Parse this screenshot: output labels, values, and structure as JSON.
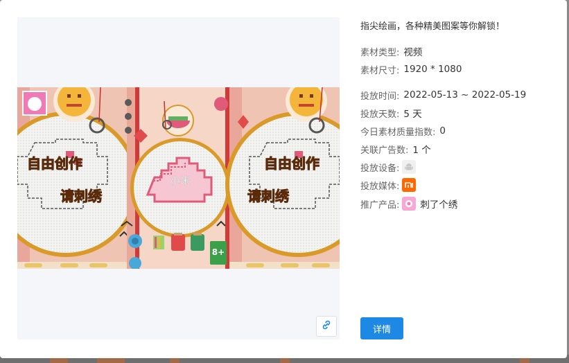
{
  "modal": {
    "title": "指尖绘画，各种精美图案等你解锁！",
    "fields": [
      {
        "label": "素材类型:",
        "value": "视频"
      },
      {
        "label": "素材尺寸:",
        "value": "1920 * 1080"
      },
      {
        "label": "投放时间:",
        "value": "2022-05-13 ~ 2022-05-19"
      },
      {
        "label": "投放天数:",
        "value": "5 天"
      },
      {
        "label": "今日素材质量指数:",
        "value": "0"
      },
      {
        "label": "关联广告数:",
        "value": "1 个"
      },
      {
        "label": "投放设备:",
        "value": ""
      },
      {
        "label": "投放媒体:",
        "value": ""
      },
      {
        "label": "推广产品:",
        "value": "刺了个绣"
      }
    ],
    "device_icon": "android-icon",
    "media_icon": "xiaomi-icon",
    "product_icon": "product-app-icon",
    "detail_button": "详情",
    "link_icon": "link-icon",
    "colors": {
      "primary": "#1e88e5",
      "xiaomi": "#ff6900"
    }
  },
  "video_frame": {
    "left_text_top": "自由创作",
    "left_text_bottom": "请刺绣",
    "center_text": "小米",
    "age_badge": "8+",
    "right_text_top": "自由创作",
    "right_text_bottom": "请刺绣"
  }
}
